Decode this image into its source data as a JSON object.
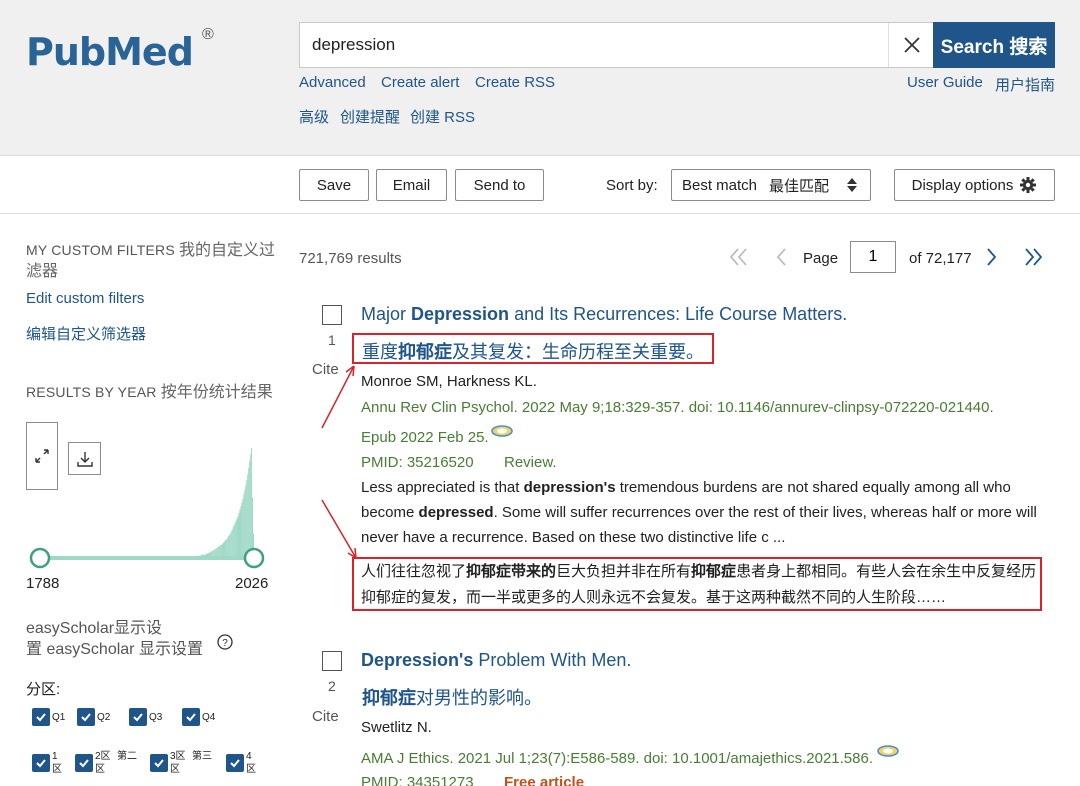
{
  "header": {
    "logo_text": "PubMed",
    "logo_reg": "®",
    "search_value": "depression",
    "search_button": "Search 搜索",
    "links": {
      "advanced": "Advanced",
      "create_alert": "Create alert",
      "create_rss": "Create RSS",
      "user_guide": "User Guide",
      "user_guide_zh": "用户指南",
      "advanced_zh": "高级",
      "create_alert_zh": "创建提醒",
      "create_rss_zh": "创建 RSS"
    }
  },
  "toolbar": {
    "save": "Save",
    "email": "Email",
    "send_to": "Send to",
    "sort_label": "Sort by:",
    "sort_value": "Best match",
    "sort_value_zh": "最佳匹配",
    "display_options": "Display options"
  },
  "sidebar": {
    "custom_filters_heading": "MY CUSTOM FILTERS",
    "custom_filters_heading_zh": "我的自定义过滤器",
    "edit_filters": "Edit custom filters",
    "edit_filters_zh": "编辑自定义筛选器",
    "results_by_year_heading": "RESULTS BY YEAR",
    "results_by_year_heading_zh": "按年份统计结果",
    "year_start": "1788",
    "year_end": "2026",
    "easyscholar_line1": "easyScholar显示设",
    "easyscholar_line2": "置 easyScholar 显示设置",
    "partition_label": "分区:",
    "quartiles": [
      "Q1",
      "Q2",
      "Q3",
      "Q4"
    ],
    "cas_zones": [
      {
        "line1": "1",
        "line2": "区",
        "extra": ""
      },
      {
        "line1": "2区",
        "line2": "区",
        "extra": "第二"
      },
      {
        "line1": "3区",
        "line2": "区",
        "extra": "第三"
      },
      {
        "line1": "4",
        "line2": "区",
        "extra": ""
      }
    ]
  },
  "results": {
    "count": "721,769 results",
    "page_label": "Page",
    "page_value": "1",
    "of_pages": "of 72,177",
    "items": [
      {
        "number": "1",
        "cite": "Cite",
        "title_pre": "Major ",
        "title_bold": "Depression",
        "title_post": " and Its Recurrences: Life Course Matters.",
        "title_zh_pre": "重度",
        "title_zh_bold": "抑郁症",
        "title_zh_post": "及其复发：生命历程至关重要。",
        "authors": "Monroe SM, Harkness KL.",
        "journal": "Annu Rev Clin Psychol. 2022 May 9;18:329-357. doi: 10.1146/annurev-clinpsy-072220-021440.",
        "epub": "Epub 2022 Feb 25.",
        "pmid": "PMID: 35216520",
        "type": "Review.",
        "snippet_1": "Less appreciated is that ",
        "snippet_b1": "depression's",
        "snippet_2": " tremendous burdens are not shared equally among all who become ",
        "snippet_b2": "depressed",
        "snippet_3": ". Some will suffer recurrences over the rest of their lives, whereas half or more will never have a recurrence. Based on these two distinctive life c ...",
        "snippet_zh_1": "人们往往忽视了",
        "snippet_zh_b1": "抑郁症带来的",
        "snippet_zh_2": "巨大负担并非在所有",
        "snippet_zh_b2": "抑郁症",
        "snippet_zh_3": "患者身上都相同。有些人会在余生中反复经历抑郁症的复发，而一半或更多的人则永远不会复发。基于这两种截然不同的人生阶段……"
      },
      {
        "number": "2",
        "cite": "Cite",
        "title_bold": "Depression's",
        "title_post": " Problem With Men.",
        "title_zh_bold": "抑郁症",
        "title_zh_post": "对男性的影响。",
        "authors": "Swetlitz N.",
        "journal": "AMA J Ethics. 2021 Jul 1;23(7):E586-589. doi: 10.1001/amajethics.2021.586.",
        "pmid": "PMID: 34351273",
        "free": "Free article"
      }
    ]
  },
  "chart_data": {
    "type": "bar",
    "x_range": [
      1788,
      2026
    ],
    "values": [
      0,
      0,
      0,
      0,
      0,
      0,
      0,
      0,
      0,
      0,
      0,
      0,
      0,
      0,
      0,
      0,
      0,
      0,
      0,
      0,
      0,
      0,
      0,
      0,
      0,
      0,
      0,
      0,
      0,
      0,
      0,
      0,
      0,
      0,
      0,
      0,
      0,
      0,
      0,
      0,
      0,
      0,
      0,
      0,
      0,
      0,
      0,
      0,
      0,
      0,
      0,
      0,
      0,
      0,
      0,
      0,
      0,
      0,
      0,
      0,
      0,
      0,
      0,
      0,
      0,
      0,
      0,
      0,
      0,
      0,
      0,
      0,
      0,
      0,
      0,
      0,
      0,
      0,
      0,
      0,
      0,
      0,
      0,
      0,
      0,
      0,
      0,
      0,
      0,
      0,
      0,
      0,
      0,
      0,
      0,
      0,
      0,
      0,
      0,
      0,
      0,
      0,
      0,
      0,
      0,
      0,
      0,
      0,
      0,
      0,
      0,
      0,
      0,
      0,
      0,
      0,
      0,
      0,
      0,
      0,
      0,
      0,
      0,
      0,
      0,
      0,
      0,
      0,
      0,
      0,
      0,
      0,
      0,
      0,
      0,
      0,
      0,
      0,
      0,
      0,
      0,
      0,
      0,
      0,
      0,
      0,
      0,
      0,
      0,
      0,
      1,
      1,
      1,
      1,
      1,
      1,
      1,
      1,
      1,
      1,
      2,
      2,
      2,
      2,
      2,
      2,
      3,
      3,
      3,
      3,
      3,
      4,
      4,
      4,
      5,
      5,
      6,
      6,
      7,
      7,
      8,
      8,
      9,
      10,
      10,
      11,
      12,
      12,
      13,
      14,
      15,
      16,
      17,
      18,
      20,
      21,
      22,
      24,
      26,
      28,
      30,
      32,
      34,
      36,
      38,
      41,
      44,
      47,
      50,
      54,
      58,
      62,
      66,
      71,
      76,
      82,
      88,
      94,
      100,
      55,
      22
    ],
    "colors": {
      "bars": "#9fd8c6",
      "slider": "#3f9f7f"
    }
  }
}
